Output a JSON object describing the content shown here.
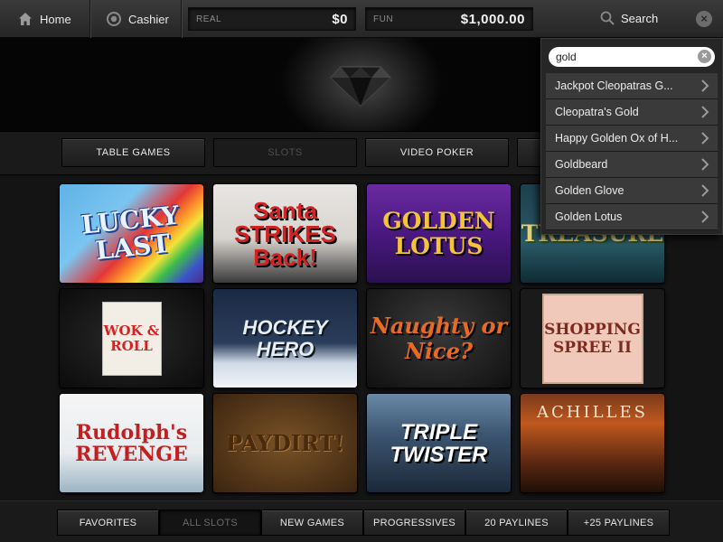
{
  "topbar": {
    "home_label": "Home",
    "cashier_label": "Cashier",
    "real": {
      "label": "REAL",
      "value": "$0"
    },
    "fun": {
      "label": "FUN",
      "value": "$1,000.00"
    },
    "search_label": "Search"
  },
  "categories": [
    {
      "label": "TABLE GAMES",
      "active": false
    },
    {
      "label": "SLOTS",
      "active": true
    },
    {
      "label": "VIDEO POKER",
      "active": false
    },
    {
      "label": "",
      "active": false
    }
  ],
  "games": [
    {
      "title": "LUCKY LAST"
    },
    {
      "title": "Santa STRIKES Back!"
    },
    {
      "title": "GOLDEN LOTUS"
    },
    {
      "title": "TREASURE"
    },
    {
      "title": "WOK & ROLL"
    },
    {
      "title": "HOCKEY HERO"
    },
    {
      "title": "Naughty or Nice?"
    },
    {
      "title": "SHOPPING SPREE II"
    },
    {
      "title": "Rudolph's REVENGE"
    },
    {
      "title": "PAYDIRT!"
    },
    {
      "title": "TRIPLE TWISTER"
    },
    {
      "title": "ACHILLES"
    }
  ],
  "filters": [
    {
      "label": "FAVORITES",
      "active": false
    },
    {
      "label": "ALL SLOTS",
      "active": true
    },
    {
      "label": "NEW GAMES",
      "active": false
    },
    {
      "label": "PROGRESSIVES",
      "active": false
    },
    {
      "label": "20 PAYLINES",
      "active": false
    },
    {
      "label": "+25 PAYLINES",
      "active": false
    }
  ],
  "search": {
    "query": "gold",
    "results": [
      {
        "label": "Jackpot Cleopatras G..."
      },
      {
        "label": "Cleopatra's Gold"
      },
      {
        "label": "Happy Golden Ox of H..."
      },
      {
        "label": "Goldbeard"
      },
      {
        "label": "Golden Glove"
      },
      {
        "label": "Golden Lotus"
      }
    ]
  },
  "icons": {
    "home": "home-icon",
    "cashier": "cashier-icon",
    "search": "search-icon",
    "close": "close-icon",
    "clear": "clear-icon",
    "chevron": "chevron-right-icon",
    "next": "next-page-icon",
    "logo": "diamond-logo-icon"
  }
}
